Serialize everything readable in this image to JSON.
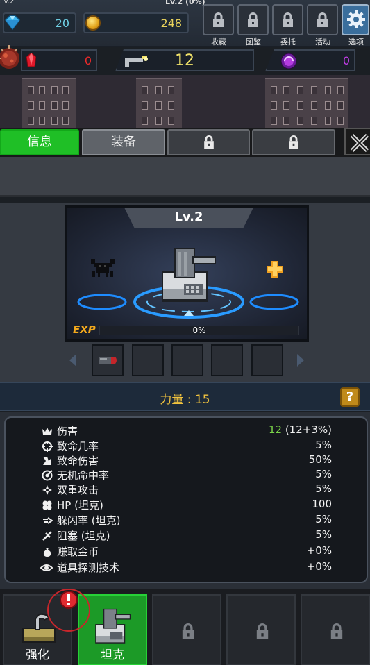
{
  "header": {
    "player_level": "Lv.2",
    "center_level": "Lv.2 (0%)",
    "gems": "20",
    "gold": "248",
    "menu": [
      {
        "label": "收藏",
        "icon": "lock-icon",
        "locked": true
      },
      {
        "label": "图鉴",
        "icon": "lock-icon",
        "locked": true
      },
      {
        "label": "委托",
        "icon": "lock-icon",
        "locked": true
      },
      {
        "label": "活动",
        "icon": "lock-icon",
        "locked": true
      },
      {
        "label": "选项",
        "icon": "gear-icon",
        "locked": false
      }
    ]
  },
  "resources": {
    "red_crystal": "0",
    "ammo_count": "12",
    "purple_orb": "0"
  },
  "tabs": [
    {
      "label": "信息",
      "active": true
    },
    {
      "label": "装备",
      "active": false
    },
    {
      "label": "",
      "locked": true
    },
    {
      "label": "",
      "locked": true
    }
  ],
  "unit": {
    "level": "Lv.2",
    "exp_label": "EXP",
    "exp_percent": "0%",
    "exp_fraction": 0.0,
    "equipment_slots": [
      {
        "icon": "bullet-icon",
        "filled": true
      },
      {
        "filled": false
      },
      {
        "filled": false
      },
      {
        "filled": false
      },
      {
        "filled": false
      }
    ]
  },
  "strength": {
    "text": "力量 : 15",
    "help_label": "?"
  },
  "stats": [
    {
      "icon": "crown-icon",
      "name": "伤害",
      "value": "12",
      "extra": " (12+3%)"
    },
    {
      "icon": "crosshair-icon",
      "name": "致命几率",
      "value": "5%",
      "extra": ""
    },
    {
      "icon": "claw-icon",
      "name": "致命伤害",
      "value": "50%",
      "extra": ""
    },
    {
      "icon": "target-icon",
      "name": "无机命中率",
      "value": "5%",
      "extra": ""
    },
    {
      "icon": "double-attack-icon",
      "name": "双重攻击",
      "value": "5%",
      "extra": ""
    },
    {
      "icon": "hp-icon",
      "name": "HP (坦克)",
      "value": "100",
      "extra": ""
    },
    {
      "icon": "dodge-icon",
      "name": "躲闪率 (坦克)",
      "value": "5%",
      "extra": ""
    },
    {
      "icon": "block-icon",
      "name": "阻塞 (坦克)",
      "value": "5%",
      "extra": ""
    },
    {
      "icon": "money-bag-icon",
      "name": "赚取金币",
      "value": "+0%",
      "extra": ""
    },
    {
      "icon": "eye-icon",
      "name": "道具探测技术",
      "value": "+0%",
      "extra": ""
    }
  ],
  "bottom_nav": [
    {
      "label": "强化",
      "icon": "upgrade-icon",
      "active": false
    },
    {
      "label": "坦克",
      "icon": "tank-icon",
      "active": true
    },
    {
      "label": "",
      "locked": true
    },
    {
      "label": "",
      "locked": true
    },
    {
      "label": "",
      "locked": true
    }
  ],
  "colors": {
    "active_green": "#1fbf26",
    "gem_value": "#6fd1e6",
    "gold_value": "#e9d35c",
    "red_value": "#ef2a2a",
    "purple_value": "#c13ce6",
    "strength_text": "#f0c23e",
    "damage_green": "#7bd54a"
  }
}
